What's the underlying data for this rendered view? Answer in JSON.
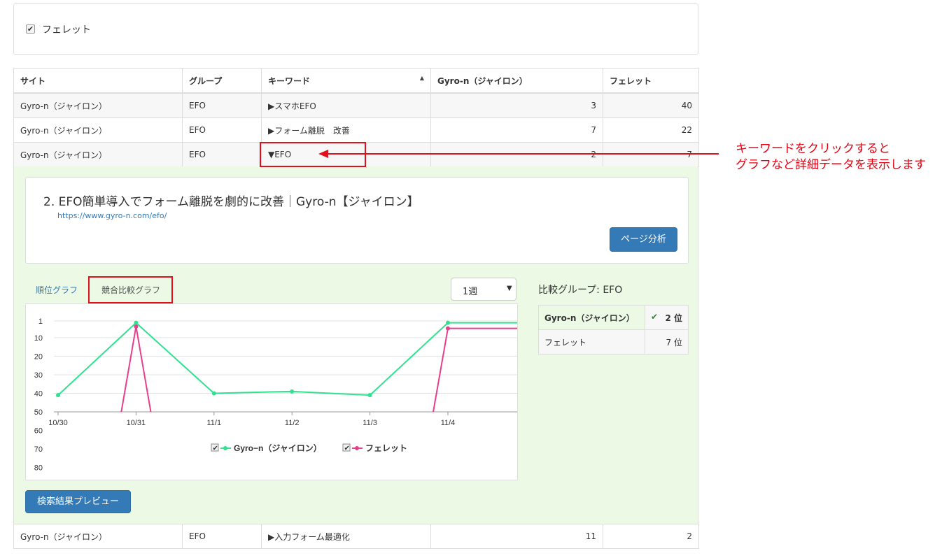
{
  "filter": {
    "checkbox_label": "フェレット",
    "checked": true
  },
  "table": {
    "headers": {
      "site": "サイト",
      "group": "グループ",
      "keyword": "キーワード",
      "gyro": "Gyro-n（ジャイロン）",
      "ferret": "フェレット"
    },
    "rows": [
      {
        "site": "Gyro-n（ジャイロン）",
        "group": "EFO",
        "keyword": "▶スマホEFO",
        "gyro": "3",
        "ferret": "40"
      },
      {
        "site": "Gyro-n（ジャイロン）",
        "group": "EFO",
        "keyword": "▶フォーム離脱　改善",
        "gyro": "7",
        "ferret": "22"
      },
      {
        "site": "Gyro-n（ジャイロン）",
        "group": "EFO",
        "keyword": "▼EFO",
        "gyro": "2",
        "ferret": "7"
      },
      {
        "site": "Gyro-n（ジャイロン）",
        "group": "EFO",
        "keyword": "▶入力フォーム最適化",
        "gyro": "11",
        "ferret": "2"
      }
    ]
  },
  "detail": {
    "page_title": "2. EFO簡単導入でフォーム離脱を劇的に改善｜Gyro-n【ジャイロン】",
    "page_url": "https://www.gyro-n.com/efo/",
    "analyze_button": "ページ分析",
    "tabs": {
      "rank_graph": "順位グラフ",
      "compare_graph": "競合比較グラフ"
    },
    "period_select": {
      "value": "1週"
    },
    "compare_group_label": "比較グループ: EFO",
    "compare_table": [
      {
        "site": "Gyro-n（ジャイロン）",
        "rank": "2 位",
        "checked": true
      },
      {
        "site": "フェレット",
        "rank": "7 位",
        "checked": false
      }
    ],
    "preview_button": "検索結果プレビュー"
  },
  "chart_data": {
    "type": "line",
    "categories": [
      "10/30",
      "10/31",
      "11/1",
      "11/2",
      "11/3",
      "11/4"
    ],
    "y_ticks": [
      1,
      10,
      20,
      30,
      40,
      50,
      60,
      70,
      80
    ],
    "y_reversed": true,
    "series": [
      {
        "name": "Gyro−n（ジャイロン）",
        "color": "#2fe28f",
        "values": [
          41,
          2,
          40,
          39,
          41,
          2
        ],
        "end_value": 2
      },
      {
        "name": "フェレット",
        "color": "#e83e8c",
        "values": [
          null,
          4,
          null,
          null,
          null,
          5
        ],
        "end_value": 5
      }
    ],
    "legend_position": "bottom"
  },
  "annotation": {
    "line1": "キーワードをクリックすると",
    "line2": "グラフなど詳細データを表示します",
    "color": "#e60012"
  }
}
